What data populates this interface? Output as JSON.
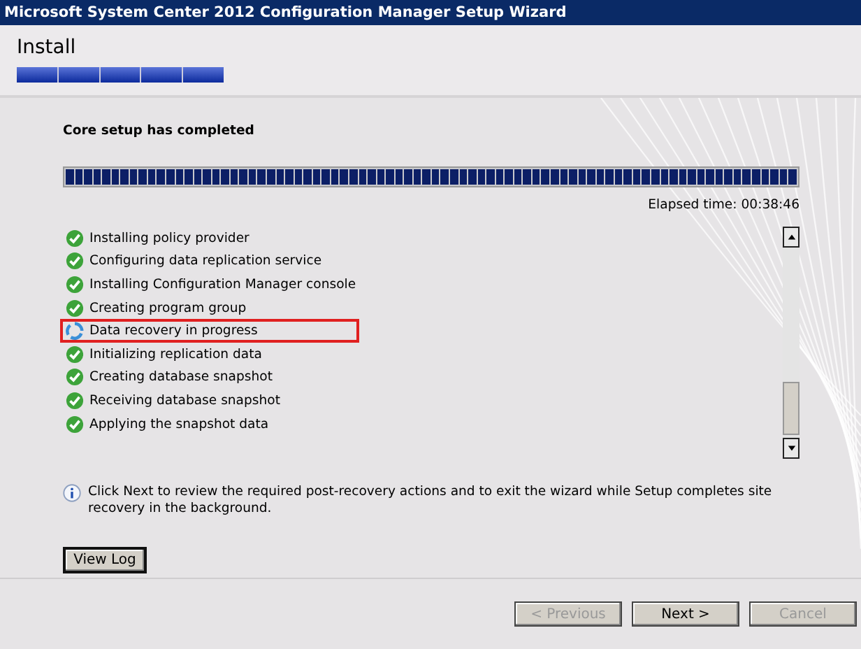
{
  "window": {
    "title": "Microsoft System Center 2012 Configuration Manager Setup Wizard"
  },
  "header": {
    "title": "Install",
    "level": 1
  },
  "status": {
    "heading": "Core setup has completed",
    "level": 1,
    "elapsed": "Elapsed time: 00:38:46"
  },
  "steps": [
    {
      "label": "Installing policy provider",
      "kind": "done",
      "highlighted": false
    },
    {
      "label": "Configuring data replication service",
      "kind": "done",
      "highlighted": false
    },
    {
      "label": "Installing Configuration Manager console",
      "kind": "done",
      "highlighted": false
    },
    {
      "label": "Creating program group",
      "kind": "done",
      "highlighted": false
    },
    {
      "label": "Data recovery in progress",
      "kind": "in_progress",
      "highlighted": true
    },
    {
      "label": "Initializing replication data",
      "kind": "done",
      "highlighted": false
    },
    {
      "label": "Creating database snapshot",
      "kind": "done",
      "highlighted": false
    },
    {
      "label": "Receiving database snapshot",
      "kind": "done",
      "highlighted": false
    },
    {
      "label": "Applying the snapshot data",
      "kind": "done",
      "highlighted": false
    }
  ],
  "info": "Click Next to review the required post-recovery actions and to exit the wizard while Setup completes site recovery in the background.",
  "view_log": "View Log",
  "buttons": [
    {
      "label": "< Previous",
      "disabled": true
    },
    {
      "label": "Next >",
      "disabled": false
    },
    {
      "label": "Cancel",
      "disabled": true
    }
  ]
}
